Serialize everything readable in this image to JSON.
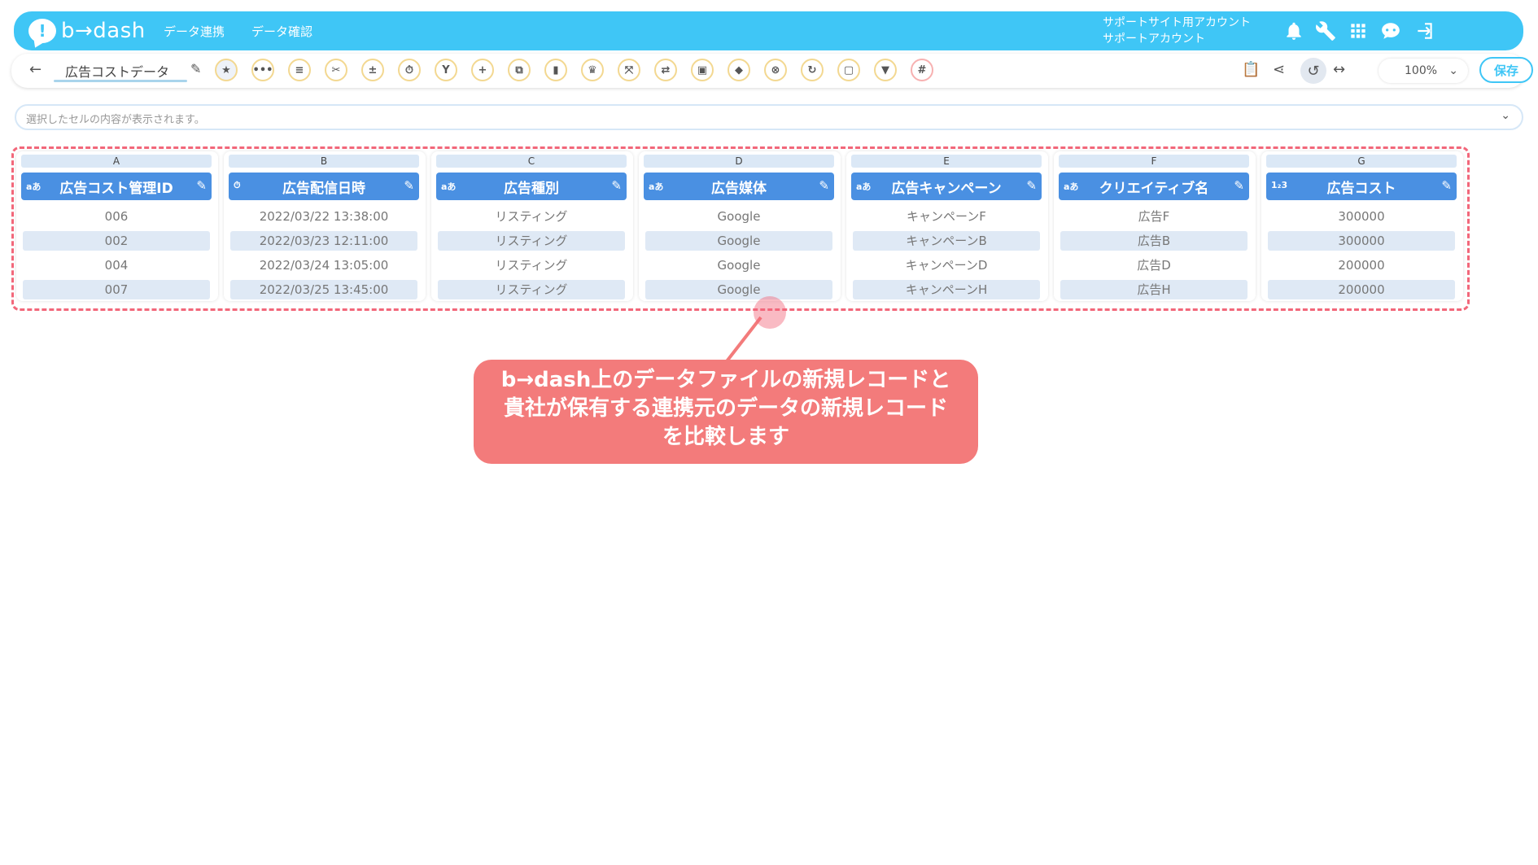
{
  "header": {
    "logo_text": "b→dash",
    "nav": [
      "データ連携",
      "データ確認"
    ],
    "account_line1": "サポートサイト用アカウント",
    "account_line2": "サポートアカウント",
    "icons": [
      "bell-icon",
      "wrench-icon",
      "apps-grid-icon",
      "support-chat-icon",
      "logout-icon"
    ]
  },
  "toolbar": {
    "back": "←",
    "title": "広告コストデータ",
    "zoom": "100%",
    "save_label": "保存",
    "tool_icons": [
      "star-icon",
      "more-icon",
      "list-icon",
      "scissors-icon",
      "formula-icon",
      "timer-icon",
      "merge-icon",
      "plus-icon",
      "copy-icon",
      "trash-icon",
      "crown-icon",
      "compress-icon",
      "loop-icon",
      "lock-icon",
      "package-icon",
      "cancel-icon",
      "refresh-icon",
      "frame-icon",
      "filter-icon",
      "grid-icon"
    ]
  },
  "cellbar": {
    "placeholder": "選択したセルの内容が表示されます。"
  },
  "columns": [
    {
      "letter": "A",
      "type": "aあ",
      "name": "広告コスト管理ID",
      "values": [
        "006",
        "002",
        "004",
        "007"
      ]
    },
    {
      "letter": "B",
      "type": "⏱",
      "name": "広告配信日時",
      "values": [
        "2022/03/22 13:38:00",
        "2022/03/23 12:11:00",
        "2022/03/24 13:05:00",
        "2022/03/25 13:45:00"
      ]
    },
    {
      "letter": "C",
      "type": "aあ",
      "name": "広告種別",
      "values": [
        "リスティング",
        "リスティング",
        "リスティング",
        "リスティング"
      ]
    },
    {
      "letter": "D",
      "type": "aあ",
      "name": "広告媒体",
      "values": [
        "Google",
        "Google",
        "Google",
        "Google"
      ]
    },
    {
      "letter": "E",
      "type": "aあ",
      "name": "広告キャンペーン",
      "values": [
        "キャンペーンF",
        "キャンペーンB",
        "キャンペーンD",
        "キャンペーンH"
      ]
    },
    {
      "letter": "F",
      "type": "aあ",
      "name": "クリエイティブ名",
      "values": [
        "広告F",
        "広告B",
        "広告D",
        "広告H"
      ]
    },
    {
      "letter": "G",
      "type": "1₂3",
      "name": "広告コスト",
      "values": [
        "300000",
        "300000",
        "200000",
        "200000"
      ]
    }
  ],
  "callout": {
    "line1": "b→dash上のデータファイルの新規レコードと",
    "line2": "貴社が保有する連携元のデータの新規レコード",
    "line3": "を比較します"
  },
  "colors": {
    "header_bg": "#3fc6f6",
    "column_header": "#4a90e2",
    "annotation": "#f37b7b"
  }
}
